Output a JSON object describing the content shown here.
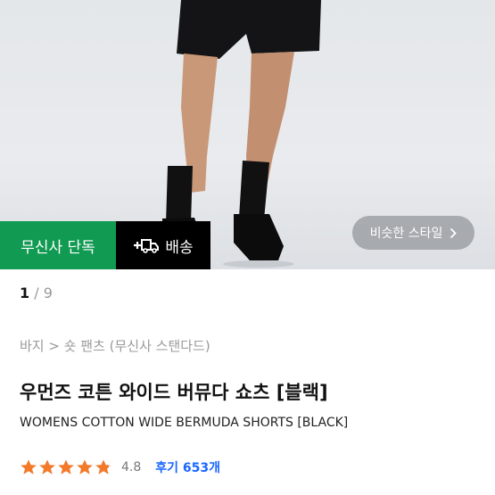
{
  "product_image": {
    "badges": {
      "exclusive": "무신사 단독",
      "shipping": "배송"
    },
    "similar_style": {
      "label": "비슷한 스타일",
      "chevron_icon": "chevron-right-icon"
    },
    "shipping_icon": "plus-truck-icon"
  },
  "gallery": {
    "current": "1",
    "separator": " / ",
    "total": "9"
  },
  "breadcrumb": "바지 > 숏 팬츠 (무신사 스탠다드)",
  "product": {
    "title_ko": "우먼즈 코튼 와이드 버뮤다 쇼츠 [블랙]",
    "title_en": "WOMENS COTTON WIDE BERMUDA SHORTS [BLACK]"
  },
  "rating": {
    "score": 4.8,
    "score_text": "4.8",
    "reviews": "후기 653개",
    "star_color": "#f27a2a"
  }
}
